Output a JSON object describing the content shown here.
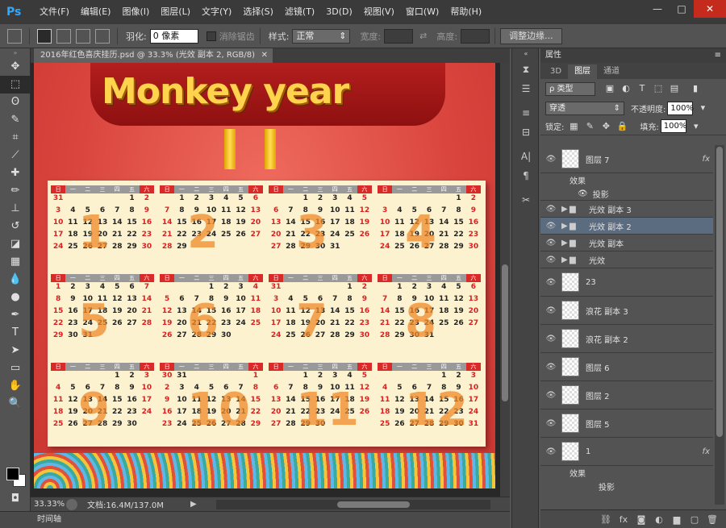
{
  "app": {
    "logo": "Ps",
    "menu": [
      "文件(F)",
      "编辑(E)",
      "图像(I)",
      "图层(L)",
      "文字(Y)",
      "选择(S)",
      "滤镜(T)",
      "3D(D)",
      "视图(V)",
      "窗口(W)",
      "帮助(H)"
    ],
    "window_controls": [
      "—",
      "□",
      "✕"
    ]
  },
  "options": {
    "feather_label": "羽化:",
    "feather_value": "0 像素",
    "antialias_label": "消除锯齿",
    "style_label": "样式:",
    "style_value": "正常",
    "width_label": "宽度:",
    "height_label": "高度:",
    "refine_button": "调整边缘..."
  },
  "document": {
    "tab_title": "2016年红色喜庆挂历.psd @ 33.3% (光效 副本 2, RGB/8)",
    "poster_title": "Monkey year",
    "weekday_headers": [
      "日",
      "一",
      "二",
      "三",
      "四",
      "五",
      "六"
    ]
  },
  "status": {
    "zoom": "33.33%",
    "doc_size": "文档:16.4M/137.0M"
  },
  "timeline": {
    "label": "时间轴"
  },
  "panel": {
    "header": "属性",
    "tabs": [
      "3D",
      "图层",
      "通道"
    ],
    "filter_kind": "类型",
    "blend_mode": "穿透",
    "opacity_label": "不透明度:",
    "opacity_value": "100%",
    "lock_label": "锁定:",
    "fill_label": "填充:",
    "fill_value": "100%",
    "effects_label": "效果",
    "shadow_label": "投影",
    "layers": [
      {
        "name": "图层 7",
        "fx": "fx"
      },
      {
        "name": "光效 副本 3"
      },
      {
        "name": "光效 副本 2"
      },
      {
        "name": "光效 副本"
      },
      {
        "name": "光效"
      },
      {
        "name": "23"
      },
      {
        "name": "浪花 副本 3"
      },
      {
        "name": "浪花 副本 2"
      },
      {
        "name": "图层 6"
      },
      {
        "name": "图层 2"
      },
      {
        "name": "图层 5"
      },
      {
        "name": "1",
        "fx": "fx"
      }
    ]
  },
  "calendar": {
    "months": [
      {
        "big": "1",
        "days": [
          "31",
          "",
          "",
          "",
          "",
          "1",
          "2",
          "3",
          "4",
          "5",
          "6",
          "7",
          "8",
          "9",
          "10",
          "11",
          "12",
          "13",
          "14",
          "15",
          "16",
          "17",
          "18",
          "19",
          "20",
          "21",
          "22",
          "23",
          "24",
          "25",
          "26",
          "27",
          "28",
          "29",
          "30"
        ]
      },
      {
        "big": "2",
        "days": [
          "",
          "1",
          "2",
          "3",
          "4",
          "5",
          "6",
          "7",
          "8",
          "9",
          "10",
          "11",
          "12",
          "13",
          "14",
          "15",
          "16",
          "17",
          "18",
          "19",
          "20",
          "21",
          "22",
          "23",
          "24",
          "25",
          "26",
          "27",
          "28",
          "29"
        ]
      },
      {
        "big": "3",
        "days": [
          "",
          "",
          "1",
          "2",
          "3",
          "4",
          "5",
          "6",
          "7",
          "8",
          "9",
          "10",
          "11",
          "12",
          "13",
          "14",
          "15",
          "16",
          "17",
          "18",
          "19",
          "20",
          "21",
          "22",
          "23",
          "24",
          "25",
          "26",
          "27",
          "28",
          "29",
          "30",
          "31"
        ]
      },
      {
        "big": "4",
        "days": [
          "",
          "",
          "",
          "",
          "",
          "1",
          "2",
          "3",
          "4",
          "5",
          "6",
          "7",
          "8",
          "9",
          "10",
          "11",
          "12",
          "13",
          "14",
          "15",
          "16",
          "17",
          "18",
          "19",
          "20",
          "21",
          "22",
          "23",
          "24",
          "25",
          "26",
          "27",
          "28",
          "29",
          "30"
        ]
      },
      {
        "big": "5",
        "days": [
          "1",
          "2",
          "3",
          "4",
          "5",
          "6",
          "7",
          "8",
          "9",
          "10",
          "11",
          "12",
          "13",
          "14",
          "15",
          "16",
          "17",
          "18",
          "19",
          "20",
          "21",
          "22",
          "23",
          "24",
          "25",
          "26",
          "27",
          "28",
          "29",
          "30",
          "31"
        ]
      },
      {
        "big": "6",
        "days": [
          "",
          "",
          "",
          "1",
          "2",
          "3",
          "4",
          "5",
          "6",
          "7",
          "8",
          "9",
          "10",
          "11",
          "12",
          "13",
          "14",
          "15",
          "16",
          "17",
          "18",
          "19",
          "20",
          "21",
          "22",
          "23",
          "24",
          "25",
          "26",
          "27",
          "28",
          "29",
          "30"
        ]
      },
      {
        "big": "7",
        "days": [
          "31",
          "",
          "",
          "",
          "",
          "1",
          "2",
          "3",
          "4",
          "5",
          "6",
          "7",
          "8",
          "9",
          "10",
          "11",
          "12",
          "13",
          "14",
          "15",
          "16",
          "17",
          "18",
          "19",
          "20",
          "21",
          "22",
          "23",
          "24",
          "25",
          "26",
          "27",
          "28",
          "29",
          "30"
        ]
      },
      {
        "big": "8",
        "days": [
          "",
          "1",
          "2",
          "3",
          "4",
          "5",
          "6",
          "7",
          "8",
          "9",
          "10",
          "11",
          "12",
          "13",
          "14",
          "15",
          "16",
          "17",
          "18",
          "19",
          "20",
          "21",
          "22",
          "23",
          "24",
          "25",
          "26",
          "27",
          "28",
          "29",
          "30",
          "31"
        ]
      },
      {
        "big": "9",
        "days": [
          "",
          "",
          "",
          "",
          "1",
          "2",
          "3",
          "4",
          "5",
          "6",
          "7",
          "8",
          "9",
          "10",
          "11",
          "12",
          "13",
          "14",
          "15",
          "16",
          "17",
          "18",
          "19",
          "20",
          "21",
          "22",
          "23",
          "24",
          "25",
          "26",
          "27",
          "28",
          "29",
          "30"
        ]
      },
      {
        "big": "10",
        "days": [
          "30",
          "31",
          "",
          "",
          "",
          "",
          "1",
          "2",
          "3",
          "4",
          "5",
          "6",
          "7",
          "8",
          "9",
          "10",
          "11",
          "12",
          "13",
          "14",
          "15",
          "16",
          "17",
          "18",
          "19",
          "20",
          "21",
          "22",
          "23",
          "24",
          "25",
          "26",
          "27",
          "28",
          "29"
        ]
      },
      {
        "big": "11",
        "days": [
          "",
          "",
          "1",
          "2",
          "3",
          "4",
          "5",
          "6",
          "7",
          "8",
          "9",
          "10",
          "11",
          "12",
          "13",
          "14",
          "15",
          "16",
          "17",
          "18",
          "19",
          "20",
          "21",
          "22",
          "23",
          "24",
          "25",
          "26",
          "27",
          "28",
          "29",
          "30"
        ]
      },
      {
        "big": "12",
        "days": [
          "",
          "",
          "",
          "",
          "1",
          "2",
          "3",
          "4",
          "5",
          "6",
          "7",
          "8",
          "9",
          "10",
          "11",
          "12",
          "13",
          "14",
          "15",
          "16",
          "17",
          "18",
          "19",
          "20",
          "21",
          "22",
          "23",
          "24",
          "25",
          "26",
          "27",
          "28",
          "29",
          "30",
          "31"
        ]
      }
    ]
  }
}
